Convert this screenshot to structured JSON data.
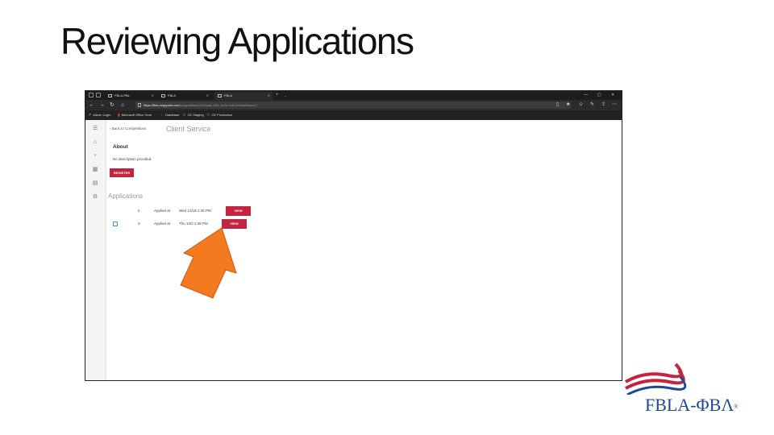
{
  "slide": {
    "title": "Reviewing Applications"
  },
  "browser": {
    "tabs": [
      {
        "label": "FBLA-PBL"
      },
      {
        "label": "FBLA"
      },
      {
        "label": "FBLA"
      }
    ],
    "url_host": "https://fbla.mojopark.com",
    "url_path": "/competitions/2b81aa1-d8f1-4c0e-bc6c-b94bd55eea7f",
    "favorites": [
      {
        "label": "Admin Login",
        "icon": "arrow-icon"
      },
      {
        "label": "Microsoft Office Hom",
        "icon": "office-icon"
      },
      {
        "label": "Database",
        "icon": "database-icon"
      },
      {
        "label": "CE Staging",
        "icon": "star-icon"
      },
      {
        "label": "CE Production",
        "icon": "star-icon"
      }
    ]
  },
  "app": {
    "back_label": "Back to Competitions",
    "page_title": "Client Service",
    "about_heading": "About",
    "about_text": "No description provided.",
    "register_label": "REGISTER",
    "applications_heading": "Applications",
    "applications": [
      {
        "number": "2",
        "label": "Applied at",
        "date": "Wed 12/18 1:36 PM",
        "action": "VIEW",
        "has_checkbox": false
      },
      {
        "number": "3",
        "label": "Applied at",
        "date": "Thu 1/02 1:36 PM",
        "action": "VIEW",
        "has_checkbox": true
      }
    ],
    "sidebar_icons": [
      "menu-icon",
      "home-icon",
      "trophy-icon",
      "calendar-icon",
      "ticket-icon",
      "settings-icon"
    ]
  },
  "logo": {
    "text": "FBLA-ΦΒΛ",
    "registered": "®"
  },
  "colors": {
    "accent": "#c3243f",
    "arrow": "#f47a20",
    "logo_blue": "#1d4b8f",
    "logo_red": "#c3243f"
  }
}
